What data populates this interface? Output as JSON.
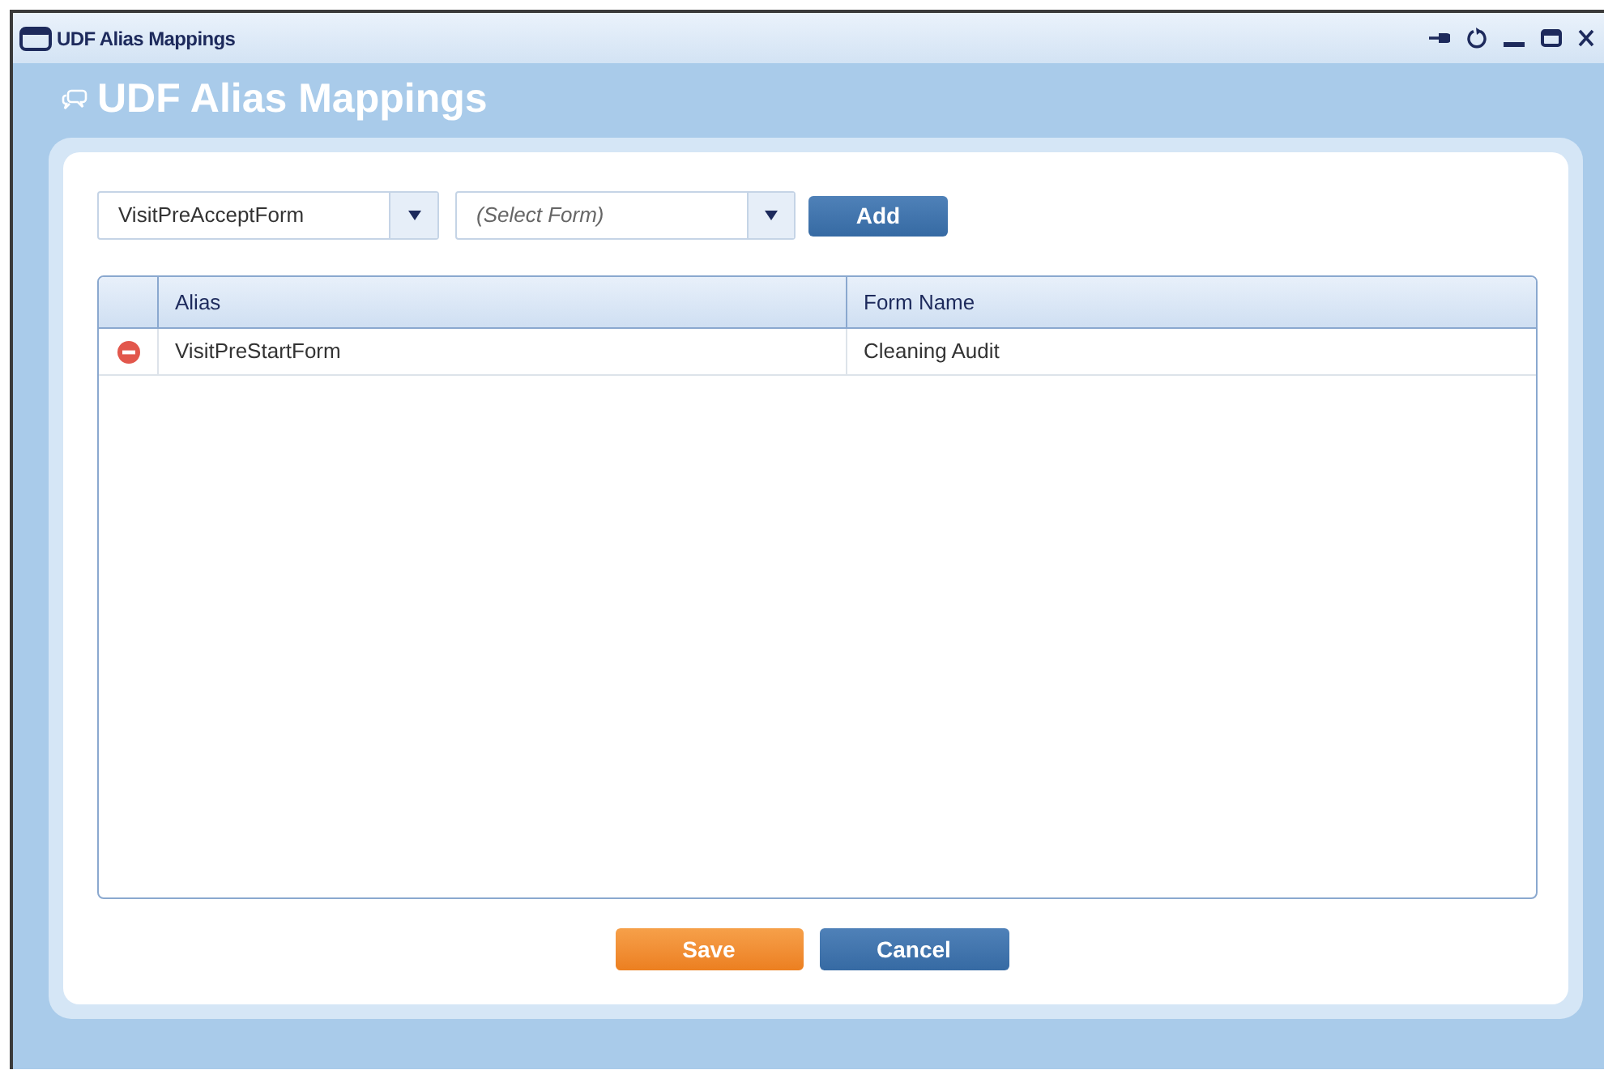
{
  "window": {
    "title": "UDF Alias Mappings"
  },
  "header": {
    "title": "UDF Alias Mappings"
  },
  "alias_select": {
    "value": "VisitPreAcceptForm"
  },
  "form_select": {
    "placeholder": "(Select Form)"
  },
  "add_button": "Add",
  "table": {
    "columns": [
      "Alias",
      "Form Name"
    ],
    "rows": [
      {
        "alias": "VisitPreStartForm",
        "form_name": "Cleaning Audit"
      }
    ]
  },
  "buttons": [
    {
      "label": "Save",
      "kind": "primary"
    },
    {
      "label": "Cancel",
      "kind": "secondary"
    }
  ]
}
